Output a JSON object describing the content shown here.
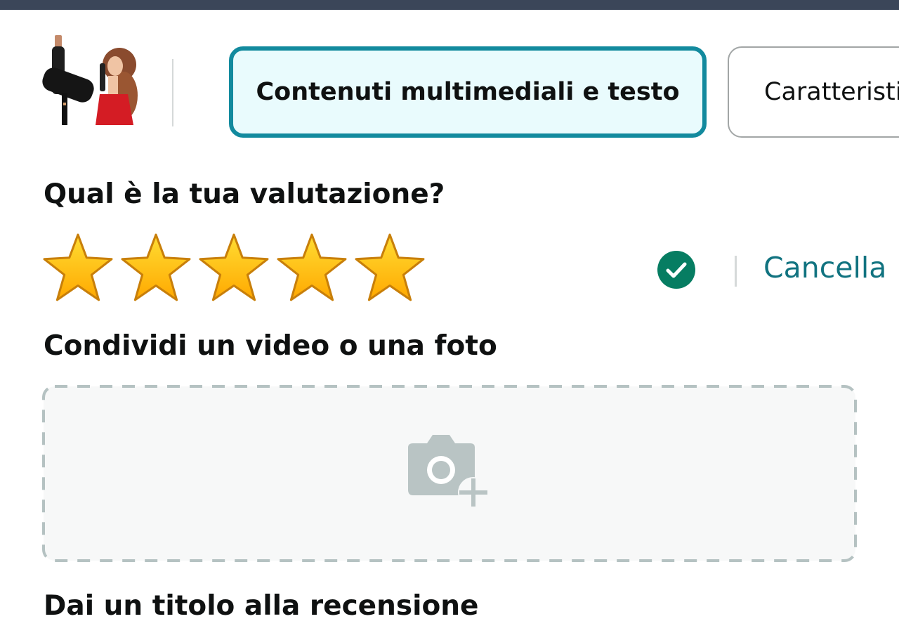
{
  "tabs": [
    {
      "label": "Contenuti multimediali e testo",
      "selected": true
    },
    {
      "label": "Caratteristi",
      "selected": false
    }
  ],
  "rating": {
    "heading": "Qual è la tua valutazione?",
    "value": 5,
    "max": 5,
    "confirmed_icon": "check-circle-icon",
    "clear_label": "Cancella"
  },
  "media": {
    "heading": "Condividi un video o una foto",
    "upload_icon": "camera-add-icon"
  },
  "review_title": {
    "heading": "Dai un titolo alla recensione"
  },
  "colors": {
    "accent": "#128a9e",
    "accent_bg": "#e9fbfd",
    "link": "#117380",
    "star_fill": "#ffb400",
    "star_stroke": "#c87f0a",
    "check": "#067d62",
    "topbar": "#3b4659"
  }
}
